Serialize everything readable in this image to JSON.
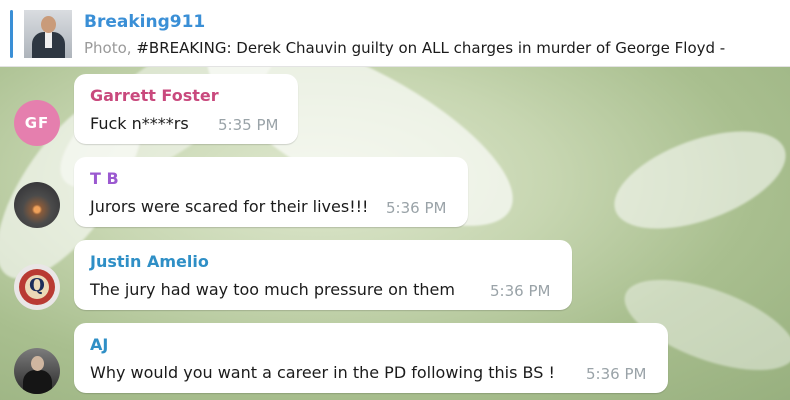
{
  "pinned": {
    "channel_name": "Breaking911",
    "media_type": "Photo,",
    "text": " #BREAKING: Derek Chauvin guilty on ALL charges in murder of George Floyd -"
  },
  "messages": [
    {
      "sender": "Garrett Foster",
      "sender_color": "#c9497d",
      "avatar_initials": "GF",
      "avatar_color": "#e57fae",
      "text": "Fuck n****rs",
      "time": "5:35 PM"
    },
    {
      "sender": "T B",
      "sender_color": "#9b59d0",
      "avatar_kind": "sunset-photo",
      "text": "Jurors were scared for their lives!!!",
      "time": "5:36 PM"
    },
    {
      "sender": "Justin Amelio",
      "sender_color": "#2f8fc6",
      "avatar_kind": "q-logo",
      "text": "The jury had way too much pressure on them",
      "time": "5:36 PM"
    },
    {
      "sender": "AJ",
      "sender_color": "#2f8fc6",
      "avatar_kind": "person-photo",
      "text": "Why would you want a career in the PD following this BS !",
      "time": "5:36 PM"
    }
  ]
}
